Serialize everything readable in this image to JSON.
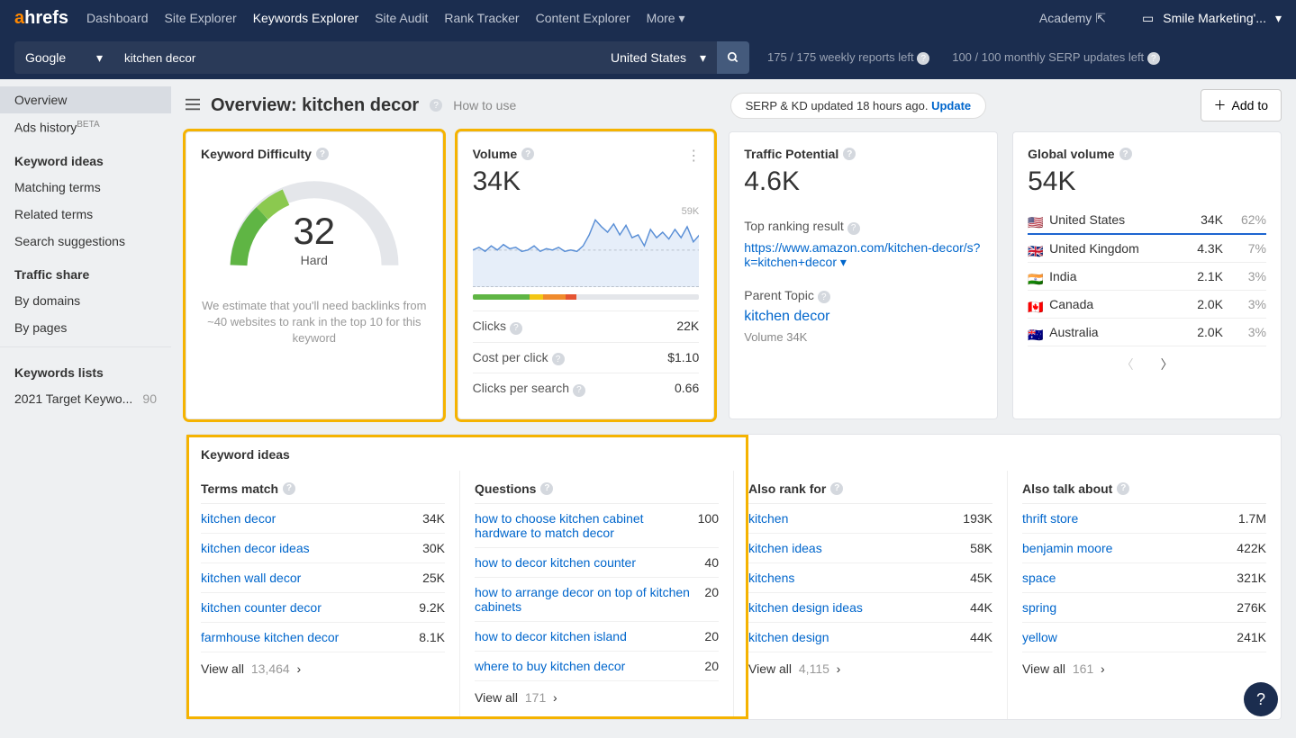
{
  "nav": {
    "items": [
      "Dashboard",
      "Site Explorer",
      "Keywords Explorer",
      "Site Audit",
      "Rank Tracker",
      "Content Explorer",
      "More"
    ],
    "active_index": 2,
    "academy": "Academy",
    "account": "Smile Marketing'..."
  },
  "search": {
    "engine": "Google",
    "query": "kitchen decor",
    "country": "United States",
    "stat_reports": "175 / 175 weekly reports left",
    "stat_serp": "100 / 100 monthly SERP updates left"
  },
  "sidebar": {
    "overview": "Overview",
    "ads_history": "Ads history",
    "beta": "BETA",
    "ideas_head": "Keyword ideas",
    "ideas": [
      "Matching terms",
      "Related terms",
      "Search suggestions"
    ],
    "traffic_head": "Traffic share",
    "traffic": [
      "By domains",
      "By pages"
    ],
    "lists_head": "Keywords lists",
    "list_name": "2021 Target Keywo...",
    "list_count": "90"
  },
  "page": {
    "title": "Overview: kitchen decor",
    "howto": "How to use",
    "pill_text": "SERP & KD updated 18 hours ago. ",
    "pill_link": "Update",
    "add": "Add to"
  },
  "kd": {
    "head": "Keyword Difficulty",
    "value": "32",
    "label": "Hard",
    "note": "We estimate that you'll need backlinks from ~40 websites to rank in the top 10 for this keyword"
  },
  "volume": {
    "head": "Volume",
    "value": "34K",
    "max": "59K",
    "clicks_l": "Clicks",
    "clicks_v": "22K",
    "cpc_l": "Cost per click",
    "cpc_v": "$1.10",
    "cps_l": "Clicks per search",
    "cps_v": "0.66",
    "chart_data": {
      "type": "line",
      "ylim": [
        0,
        59000
      ],
      "y": [
        27000,
        29000,
        26000,
        30000,
        27000,
        31000,
        28000,
        29000,
        26000,
        27000,
        30000,
        26000,
        28000,
        27000,
        29000,
        26000,
        27000,
        26000,
        30000,
        38000,
        49000,
        44000,
        40000,
        46000,
        38000,
        45000,
        36000,
        38000,
        30000,
        42000,
        36000,
        40000,
        35000,
        42000,
        36000,
        44000,
        33000,
        38000
      ]
    }
  },
  "traffic_potential": {
    "head": "Traffic Potential",
    "value": "4.6K",
    "top_label": "Top ranking result",
    "top_url": "https://www.amazon.com/kitchen-decor/s?k=kitchen+decor",
    "parent_label": "Parent Topic",
    "parent_topic": "kitchen decor",
    "parent_vol": "Volume 34K"
  },
  "global": {
    "head": "Global volume",
    "value": "54K",
    "countries": [
      {
        "flag": "🇺🇸",
        "name": "United States",
        "vol": "34K",
        "pct": "62%"
      },
      {
        "flag": "🇬🇧",
        "name": "United Kingdom",
        "vol": "4.3K",
        "pct": "7%"
      },
      {
        "flag": "🇮🇳",
        "name": "India",
        "vol": "2.1K",
        "pct": "3%"
      },
      {
        "flag": "🇨🇦",
        "name": "Canada",
        "vol": "2.0K",
        "pct": "3%"
      },
      {
        "flag": "🇦🇺",
        "name": "Australia",
        "vol": "2.0K",
        "pct": "3%"
      }
    ]
  },
  "ideas": {
    "head": "Keyword ideas",
    "cols": [
      {
        "title": "Terms match",
        "viewall": "View all",
        "count": "13,464",
        "rows": [
          {
            "k": "kitchen decor",
            "v": "34K"
          },
          {
            "k": "kitchen decor ideas",
            "v": "30K"
          },
          {
            "k": "kitchen wall decor",
            "v": "25K"
          },
          {
            "k": "kitchen counter decor",
            "v": "9.2K"
          },
          {
            "k": "farmhouse kitchen decor",
            "v": "8.1K"
          }
        ]
      },
      {
        "title": "Questions",
        "viewall": "View all",
        "count": "171",
        "rows": [
          {
            "k": "how to choose kitchen cabinet hardware to match decor",
            "v": "100"
          },
          {
            "k": "how to decor kitchen counter",
            "v": "40"
          },
          {
            "k": "how to arrange decor on top of kitchen cabinets",
            "v": "20"
          },
          {
            "k": "how to decor kitchen island",
            "v": "20"
          },
          {
            "k": "where to buy kitchen decor",
            "v": "20"
          }
        ]
      },
      {
        "title": "Also rank for",
        "viewall": "View all",
        "count": "4,115",
        "rows": [
          {
            "k": "kitchen",
            "v": "193K"
          },
          {
            "k": "kitchen ideas",
            "v": "58K"
          },
          {
            "k": "kitchens",
            "v": "45K"
          },
          {
            "k": "kitchen design ideas",
            "v": "44K"
          },
          {
            "k": "kitchen design",
            "v": "44K"
          }
        ]
      },
      {
        "title": "Also talk about",
        "viewall": "View all",
        "count": "161",
        "rows": [
          {
            "k": "thrift store",
            "v": "1.7M"
          },
          {
            "k": "benjamin moore",
            "v": "422K"
          },
          {
            "k": "space",
            "v": "321K"
          },
          {
            "k": "spring",
            "v": "276K"
          },
          {
            "k": "yellow",
            "v": "241K"
          }
        ]
      }
    ]
  }
}
